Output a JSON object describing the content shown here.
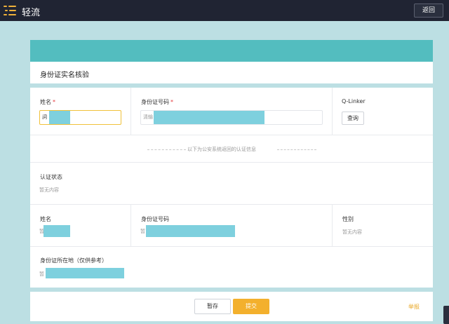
{
  "app": {
    "name": "轻流",
    "back_label": "返回"
  },
  "page": {
    "title": "身份证实名核验"
  },
  "form": {
    "name_label": "姓名",
    "id_label": "身份证号码",
    "required_mark": "*",
    "name_value": "詞",
    "id_placeholder": "清输",
    "qlinker_label": "Q-Linker",
    "query_label": "查询",
    "separator_text": "以下为公安系统返回的认证信息"
  },
  "result": {
    "status_label": "认证状态",
    "status_value": "暂无内容",
    "name_label": "姓名",
    "name_value": "暂",
    "id_label": "身份证号码",
    "id_value": "暂",
    "gender_label": "性别",
    "gender_value": "暂无内容",
    "location_label": "身份证所在地（仅供参考）",
    "location_value": "暂"
  },
  "footer": {
    "save_label": "暂存",
    "submit_label": "提交",
    "report_label": "举报"
  },
  "colors": {
    "topbar": "#202433",
    "teal": "#53bdbf",
    "accent": "#f3b02d",
    "mask": "#7ed0de",
    "background": "#bcdfe3"
  }
}
